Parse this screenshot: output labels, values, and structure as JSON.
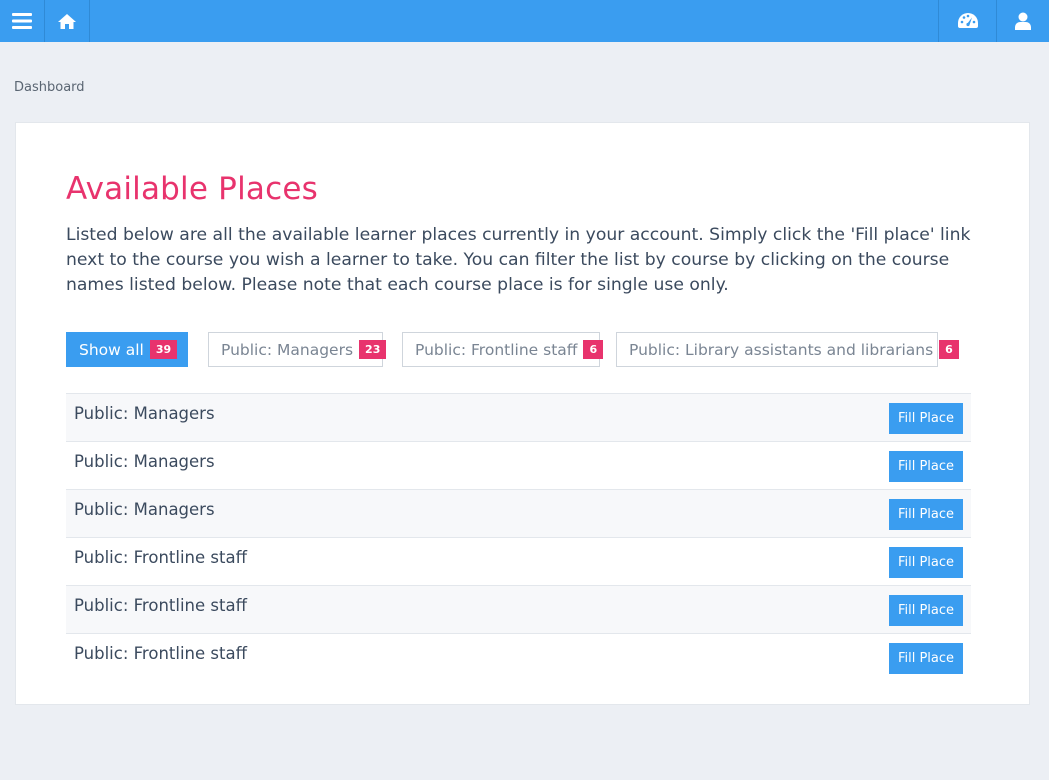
{
  "topbar": {
    "menu_icon": "hamburger-menu-icon",
    "home_icon": "home-icon",
    "dashboard_icon": "dashboard-gauge-icon",
    "user_icon": "user-icon"
  },
  "breadcrumb": {
    "label": "Dashboard"
  },
  "page": {
    "title": "Available Places",
    "intro": "Listed below are all the available learner places currently in your account. Simply click the 'Fill place' link next to the course you wish a learner to take. You can filter the list by course by clicking on the course names listed below. Please note that each course place is for single use only."
  },
  "filters": [
    {
      "label": "Show all",
      "count": "39",
      "active": true
    },
    {
      "label": "Public: Managers",
      "count": "23",
      "active": false
    },
    {
      "label": "Public: Frontline staff",
      "count": "6",
      "active": false
    },
    {
      "label": "Public: Library assistants and librarians",
      "count": "6",
      "active": false
    }
  ],
  "places": [
    {
      "course": "Public: Managers",
      "action": "Fill Place"
    },
    {
      "course": "Public: Managers",
      "action": "Fill Place"
    },
    {
      "course": "Public: Managers",
      "action": "Fill Place"
    },
    {
      "course": "Public: Frontline staff",
      "action": "Fill Place"
    },
    {
      "course": "Public: Frontline staff",
      "action": "Fill Place"
    },
    {
      "course": "Public: Frontline staff",
      "action": "Fill Place"
    }
  ],
  "colors": {
    "accent": "#3a9df0",
    "title": "#e8336d",
    "badge": "#e8336d",
    "background": "#eceff4"
  }
}
